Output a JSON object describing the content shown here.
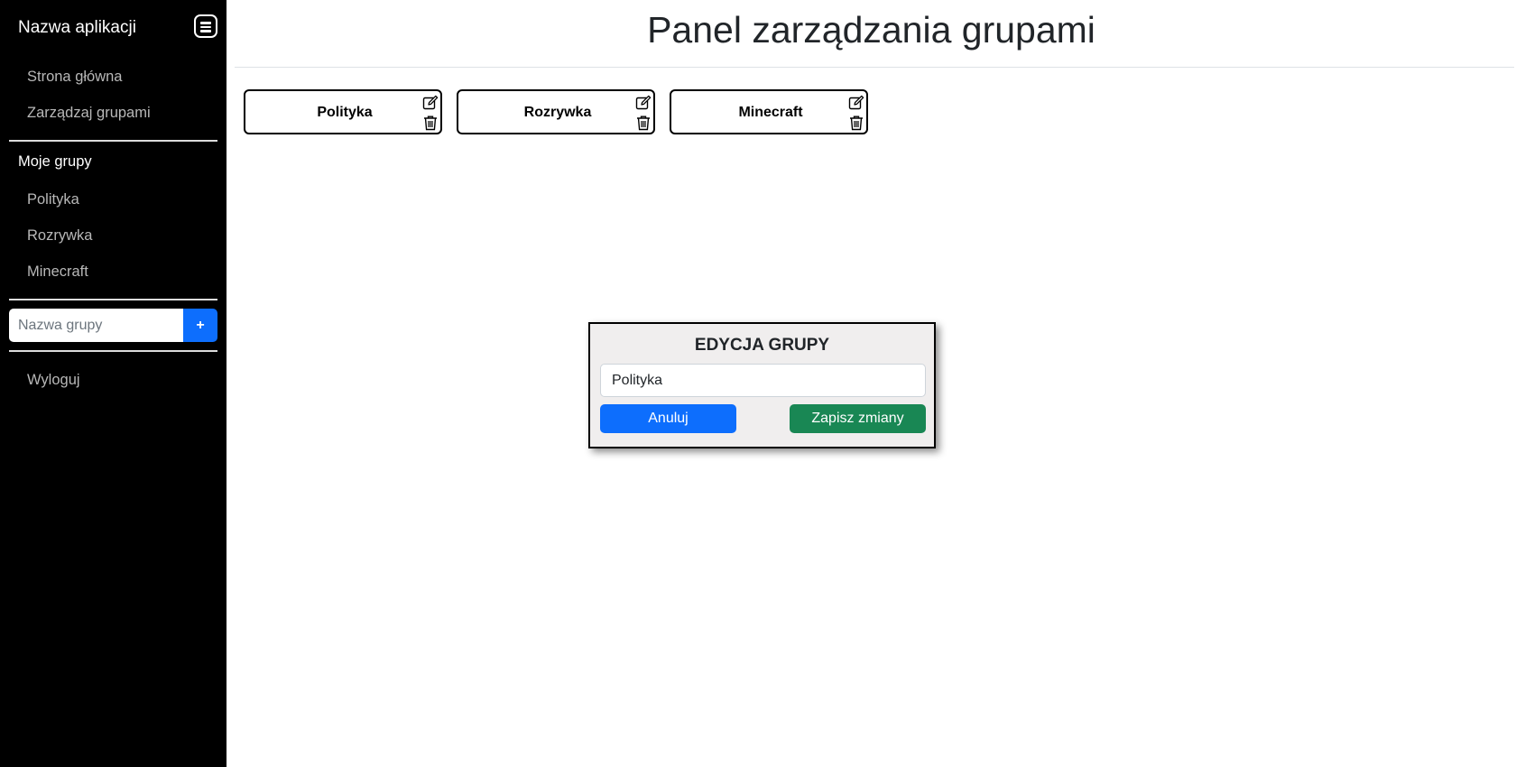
{
  "sidebar": {
    "app_name": "Nazwa aplikacji",
    "links": [
      {
        "label": "Strona główna"
      },
      {
        "label": "Zarządzaj grupami"
      }
    ],
    "my_groups_heading": "Moje grupy",
    "groups": [
      {
        "label": "Polityka"
      },
      {
        "label": "Rozrywka"
      },
      {
        "label": "Minecraft"
      }
    ],
    "new_group": {
      "placeholder": "Nazwa grupy",
      "add_label": "+"
    },
    "logout_label": "Wyloguj",
    "menu_icon": "hamburger-menu-icon"
  },
  "main": {
    "title": "Panel zarządzania grupami",
    "group_cards": [
      {
        "name": "Polityka"
      },
      {
        "name": "Rozrywka"
      },
      {
        "name": "Minecraft"
      }
    ],
    "card_icons": {
      "edit": "edit-icon",
      "delete": "trash-icon"
    }
  },
  "modal": {
    "title": "EDYCJA GRUPY",
    "input_value": "Polityka",
    "cancel_label": "Anuluj",
    "save_label": "Zapisz zmiany"
  },
  "colors": {
    "sidebar_bg": "#000000",
    "primary": "#0d6efd",
    "success": "#198754",
    "modal_bg": "#f0eeee"
  }
}
